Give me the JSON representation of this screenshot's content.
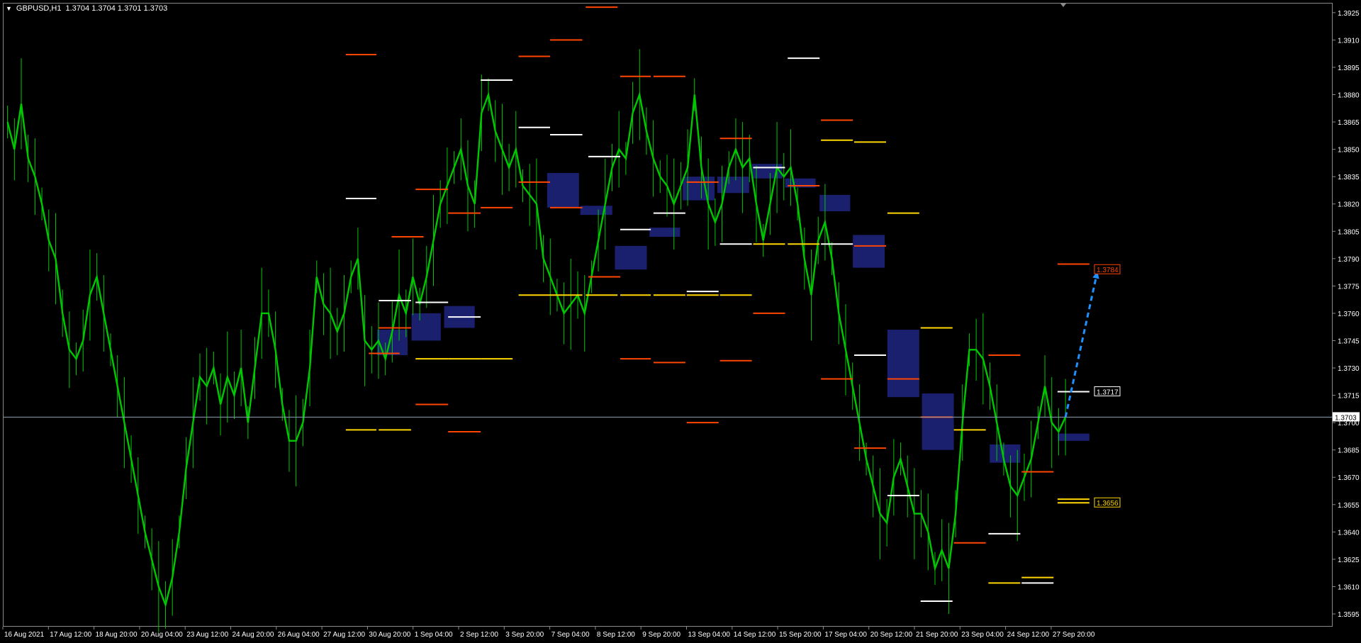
{
  "header": {
    "symbol_timeframe": "GBPUSD,H1",
    "ohlc": "1.3704 1.3704 1.3701 1.3703",
    "menu_icon": "triangle-down-icon"
  },
  "colors": {
    "candles": "#00c800",
    "resistance": "#ff4500",
    "support": "#ffd700",
    "pivot": "#ffffff",
    "zone": "#1a1f6e",
    "arrow": "#1e90ff",
    "price_line": "#8fa3b5"
  },
  "chart_data": {
    "type": "line",
    "title": "GBPUSD,H1",
    "ylim": [
      1.3588,
      1.393
    ],
    "y_ticks": [
      "1.3925",
      "1.3910",
      "1.3895",
      "1.3880",
      "1.3865",
      "1.3850",
      "1.3835",
      "1.3820",
      "1.3805",
      "1.3790",
      "1.3775",
      "1.3760",
      "1.3745",
      "1.3730",
      "1.3715",
      "1.3700",
      "1.3685",
      "1.3670",
      "1.3655",
      "1.3640",
      "1.3625",
      "1.3610",
      "1.3595"
    ],
    "x_ticks": [
      "16 Aug 2021",
      "17 Aug 12:00",
      "18 Aug 20:00",
      "20 Aug 04:00",
      "23 Aug 12:00",
      "24 Aug 20:00",
      "26 Aug 04:00",
      "27 Aug 12:00",
      "30 Aug 20:00",
      "1 Sep 04:00",
      "2 Sep 12:00",
      "3 Sep 20:00",
      "7 Sep 04:00",
      "8 Sep 12:00",
      "9 Sep 20:00",
      "13 Sep 04:00",
      "14 Sep 12:00",
      "15 Sep 20:00",
      "17 Sep 04:00",
      "20 Sep 12:00",
      "21 Sep 20:00",
      "23 Sep 04:00",
      "24 Sep 12:00",
      "27 Sep 20:00"
    ],
    "series": [
      {
        "values": [
          1.3865,
          1.385,
          1.3875,
          1.3845,
          1.3835,
          1.382,
          1.38,
          1.379,
          1.376,
          1.374,
          1.3735,
          1.3745,
          1.377,
          1.378,
          1.376,
          1.374,
          1.372,
          1.37,
          1.368,
          1.366,
          1.364,
          1.3625,
          1.361,
          1.36,
          1.3615,
          1.364,
          1.3675,
          1.37,
          1.3725,
          1.372,
          1.373,
          1.371,
          1.3725,
          1.3715,
          1.373,
          1.37,
          1.373,
          1.376,
          1.376,
          1.374,
          1.371,
          1.369,
          1.369,
          1.37,
          1.373,
          1.378,
          1.3765,
          1.376,
          1.375,
          1.376,
          1.378,
          1.379,
          1.3745,
          1.374,
          1.3745,
          1.3735,
          1.375,
          1.377,
          1.376,
          1.378,
          1.3765,
          1.378,
          1.38,
          1.382,
          1.383,
          1.384,
          1.385,
          1.383,
          1.382,
          1.387,
          1.388,
          1.386,
          1.385,
          1.384,
          1.385,
          1.383,
          1.3825,
          1.382,
          1.379,
          1.378,
          1.377,
          1.376,
          1.3765,
          1.377,
          1.376,
          1.378,
          1.38,
          1.382,
          1.384,
          1.385,
          1.3845,
          1.387,
          1.388,
          1.386,
          1.3845,
          1.3835,
          1.383,
          1.382,
          1.383,
          1.384,
          1.388,
          1.384,
          1.382,
          1.381,
          1.382,
          1.384,
          1.385,
          1.384,
          1.3845,
          1.382,
          1.38,
          1.382,
          1.384,
          1.3835,
          1.384,
          1.382,
          1.379,
          1.377,
          1.38,
          1.381,
          1.379,
          1.376,
          1.374,
          1.372,
          1.37,
          1.368,
          1.3665,
          1.365,
          1.3645,
          1.367,
          1.368,
          1.3665,
          1.365,
          1.365,
          1.364,
          1.362,
          1.363,
          1.362,
          1.365,
          1.37,
          1.374,
          1.374,
          1.3735,
          1.372,
          1.37,
          1.368,
          1.3665,
          1.366,
          1.367,
          1.368,
          1.37,
          1.372,
          1.37,
          1.3695,
          1.3703
        ]
      }
    ],
    "resistance_levels": [
      {
        "x0": 0.2575,
        "x1": 0.2805,
        "y": 1.3902
      },
      {
        "x0": 0.2823,
        "x1": 0.3066,
        "y": 1.3752
      },
      {
        "x0": 0.2748,
        "x1": 0.298,
        "y": 1.3738
      },
      {
        "x0": 0.292,
        "x1": 0.316,
        "y": 1.3802
      },
      {
        "x0": 0.31,
        "x1": 0.3345,
        "y": 1.3828
      },
      {
        "x0": 0.31,
        "x1": 0.3345,
        "y": 1.371
      },
      {
        "x0": 0.3345,
        "x1": 0.359,
        "y": 1.3815
      },
      {
        "x0": 0.3345,
        "x1": 0.359,
        "y": 1.3695
      },
      {
        "x0": 0.359,
        "x1": 0.383,
        "y": 1.3818
      },
      {
        "x0": 0.3875,
        "x1": 0.4112,
        "y": 1.3901
      },
      {
        "x0": 0.3875,
        "x1": 0.4112,
        "y": 1.3832
      },
      {
        "x0": 0.4112,
        "x1": 0.4355,
        "y": 1.391
      },
      {
        "x0": 0.4112,
        "x1": 0.4355,
        "y": 1.3818
      },
      {
        "x0": 0.438,
        "x1": 0.462,
        "y": 1.3928
      },
      {
        "x0": 0.44,
        "x1": 0.464,
        "y": 1.378
      },
      {
        "x0": 0.464,
        "x1": 0.487,
        "y": 1.389
      },
      {
        "x0": 0.464,
        "x1": 0.487,
        "y": 1.3735
      },
      {
        "x0": 0.489,
        "x1": 0.513,
        "y": 1.389
      },
      {
        "x0": 0.489,
        "x1": 0.513,
        "y": 1.3733
      },
      {
        "x0": 0.514,
        "x1": 0.538,
        "y": 1.3832
      },
      {
        "x0": 0.514,
        "x1": 0.538,
        "y": 1.37
      },
      {
        "x0": 0.539,
        "x1": 0.563,
        "y": 1.3856
      },
      {
        "x0": 0.539,
        "x1": 0.563,
        "y": 1.3734
      },
      {
        "x0": 0.564,
        "x1": 0.588,
        "y": 1.376
      },
      {
        "x0": 0.59,
        "x1": 0.614,
        "y": 1.383
      },
      {
        "x0": 0.615,
        "x1": 0.639,
        "y": 1.3866
      },
      {
        "x0": 0.615,
        "x1": 0.639,
        "y": 1.3724
      },
      {
        "x0": 0.64,
        "x1": 0.664,
        "y": 1.3797
      },
      {
        "x0": 0.64,
        "x1": 0.664,
        "y": 1.3686
      },
      {
        "x0": 0.665,
        "x1": 0.689,
        "y": 1.3724
      },
      {
        "x0": 0.69,
        "x1": 0.714,
        "y": 1.3703
      },
      {
        "x0": 0.715,
        "x1": 0.739,
        "y": 1.3634
      },
      {
        "x0": 0.741,
        "x1": 0.765,
        "y": 1.3737
      },
      {
        "x0": 0.766,
        "x1": 0.79,
        "y": 1.3673
      },
      {
        "x0": 0.793,
        "x1": 0.817,
        "y": 1.3787
      }
    ],
    "support_levels": [
      {
        "x0": 0.2575,
        "x1": 0.2805,
        "y": 1.3696
      },
      {
        "x0": 0.2823,
        "x1": 0.3066,
        "y": 1.3696
      },
      {
        "x0": 0.31,
        "x1": 0.3345,
        "y": 1.3735
      },
      {
        "x0": 0.3345,
        "x1": 0.359,
        "y": 1.3735
      },
      {
        "x0": 0.359,
        "x1": 0.383,
        "y": 1.3735
      },
      {
        "x0": 0.3875,
        "x1": 0.4112,
        "y": 1.377
      },
      {
        "x0": 0.4112,
        "x1": 0.4355,
        "y": 1.377
      },
      {
        "x0": 0.438,
        "x1": 0.462,
        "y": 1.377
      },
      {
        "x0": 0.464,
        "x1": 0.487,
        "y": 1.377
      },
      {
        "x0": 0.489,
        "x1": 0.513,
        "y": 1.377
      },
      {
        "x0": 0.514,
        "x1": 0.538,
        "y": 1.377
      },
      {
        "x0": 0.539,
        "x1": 0.563,
        "y": 1.377
      },
      {
        "x0": 0.564,
        "x1": 0.588,
        "y": 1.3798
      },
      {
        "x0": 0.59,
        "x1": 0.614,
        "y": 1.3798
      },
      {
        "x0": 0.615,
        "x1": 0.639,
        "y": 1.3855
      },
      {
        "x0": 0.64,
        "x1": 0.664,
        "y": 1.3854
      },
      {
        "x0": 0.665,
        "x1": 0.689,
        "y": 1.3815
      },
      {
        "x0": 0.69,
        "x1": 0.714,
        "y": 1.3752
      },
      {
        "x0": 0.715,
        "x1": 0.739,
        "y": 1.3696
      },
      {
        "x0": 0.741,
        "x1": 0.765,
        "y": 1.3612
      },
      {
        "x0": 0.766,
        "x1": 0.79,
        "y": 1.3615
      },
      {
        "x0": 0.793,
        "x1": 0.817,
        "y": 1.3658
      },
      {
        "x0": 0.793,
        "x1": 0.817,
        "y": 1.3656
      }
    ],
    "pivot_levels": [
      {
        "x0": 0.2575,
        "x1": 0.2805,
        "y": 1.3823
      },
      {
        "x0": 0.2823,
        "x1": 0.3066,
        "y": 1.3767
      },
      {
        "x0": 0.31,
        "x1": 0.3345,
        "y": 1.3766
      },
      {
        "x0": 0.3345,
        "x1": 0.359,
        "y": 1.3758
      },
      {
        "x0": 0.359,
        "x1": 0.383,
        "y": 1.3888
      },
      {
        "x0": 0.3875,
        "x1": 0.4112,
        "y": 1.3862
      },
      {
        "x0": 0.4112,
        "x1": 0.4355,
        "y": 1.3858
      },
      {
        "x0": 0.44,
        "x1": 0.464,
        "y": 1.3846
      },
      {
        "x0": 0.464,
        "x1": 0.487,
        "y": 1.3806
      },
      {
        "x0": 0.489,
        "x1": 0.513,
        "y": 1.3815
      },
      {
        "x0": 0.514,
        "x1": 0.538,
        "y": 1.3772
      },
      {
        "x0": 0.539,
        "x1": 0.563,
        "y": 1.3798
      },
      {
        "x0": 0.564,
        "x1": 0.588,
        "y": 1.384
      },
      {
        "x0": 0.59,
        "x1": 0.614,
        "y": 1.39
      },
      {
        "x0": 0.615,
        "x1": 0.639,
        "y": 1.3798
      },
      {
        "x0": 0.64,
        "x1": 0.664,
        "y": 1.3737
      },
      {
        "x0": 0.665,
        "x1": 0.689,
        "y": 1.366
      },
      {
        "x0": 0.69,
        "x1": 0.714,
        "y": 1.3602
      },
      {
        "x0": 0.741,
        "x1": 0.765,
        "y": 1.3639
      },
      {
        "x0": 0.766,
        "x1": 0.79,
        "y": 1.3612
      },
      {
        "x0": 0.793,
        "x1": 0.817,
        "y": 1.3717
      }
    ],
    "zones": [
      {
        "x0": 0.281,
        "x1": 0.304,
        "y0": 1.3737,
        "y1": 1.3751
      },
      {
        "x0": 0.307,
        "x1": 0.329,
        "y0": 1.3745,
        "y1": 1.376
      },
      {
        "x0": 0.3315,
        "x1": 0.3545,
        "y0": 1.3752,
        "y1": 1.3764
      },
      {
        "x0": 0.409,
        "x1": 0.433,
        "y0": 1.3818,
        "y1": 1.3837
      },
      {
        "x0": 0.434,
        "x1": 0.458,
        "y0": 1.3814,
        "y1": 1.3819
      },
      {
        "x0": 0.46,
        "x1": 0.484,
        "y0": 1.3784,
        "y1": 1.3797
      },
      {
        "x0": 0.486,
        "x1": 0.509,
        "y0": 1.3802,
        "y1": 1.3807
      },
      {
        "x0": 0.511,
        "x1": 0.535,
        "y0": 1.3822,
        "y1": 1.3835
      },
      {
        "x0": 0.537,
        "x1": 0.561,
        "y0": 1.3826,
        "y1": 1.3835
      },
      {
        "x0": 0.563,
        "x1": 0.586,
        "y0": 1.3834,
        "y1": 1.3842
      },
      {
        "x0": 0.588,
        "x1": 0.611,
        "y0": 1.3829,
        "y1": 1.3834
      },
      {
        "x0": 0.614,
        "x1": 0.637,
        "y0": 1.3816,
        "y1": 1.3825
      },
      {
        "x0": 0.639,
        "x1": 0.663,
        "y0": 1.3785,
        "y1": 1.3803
      },
      {
        "x0": 0.665,
        "x1": 0.689,
        "y0": 1.3714,
        "y1": 1.3751
      },
      {
        "x0": 0.691,
        "x1": 0.715,
        "y0": 1.3685,
        "y1": 1.3716
      },
      {
        "x0": 0.742,
        "x1": 0.765,
        "y0": 1.3678,
        "y1": 1.3688
      },
      {
        "x0": 0.793,
        "x1": 0.817,
        "y0": 1.369,
        "y1": 1.3694
      }
    ],
    "projection": {
      "from_x": 0.799,
      "from_y": 1.3703,
      "to_x": 0.823,
      "to_y": 1.3783
    },
    "price_labels": [
      {
        "text": "1.3784",
        "y": 1.3784,
        "color": "#ff4500"
      },
      {
        "text": "1.3717",
        "y": 1.3717,
        "color": "#ffffff"
      },
      {
        "text": "1.3656",
        "y": 1.3656,
        "color": "#ffd700"
      }
    ],
    "current_price": {
      "text": "1.3703",
      "y": 1.3703
    },
    "grid": false
  }
}
